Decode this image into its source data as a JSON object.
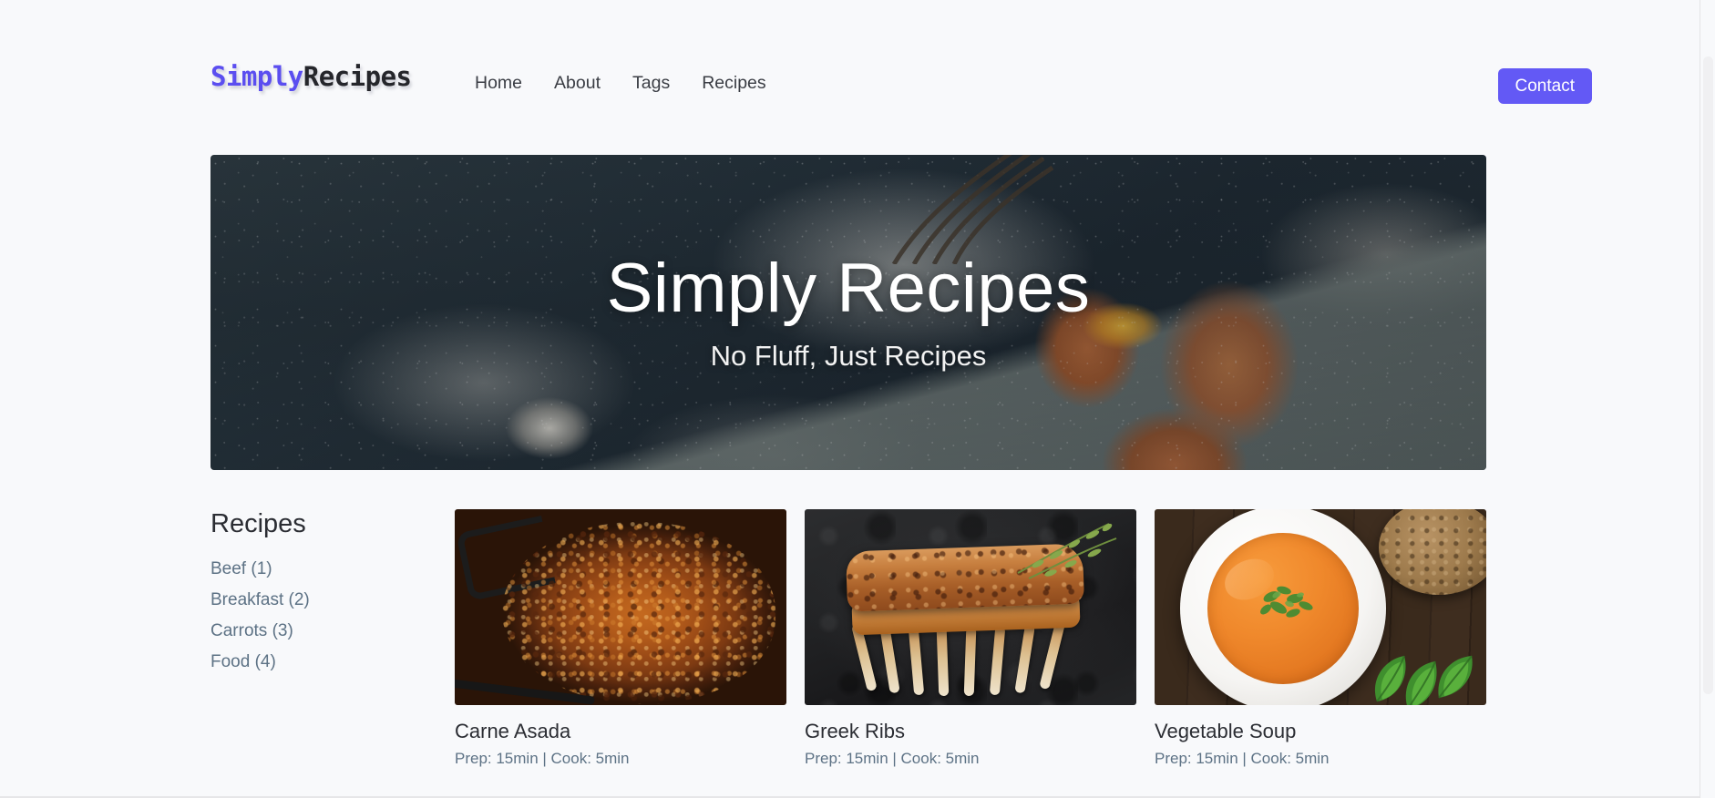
{
  "site": {
    "background_color": "#f8f9fb",
    "accent_color": "#6359f5"
  },
  "header": {
    "brand": {
      "part1": "Simply",
      "part1_color": "#5b4ef0",
      "part2": "Recipes",
      "part2_color": "#25262b"
    },
    "nav": [
      {
        "label": "Home"
      },
      {
        "label": "About"
      },
      {
        "label": "Tags"
      },
      {
        "label": "Recipes"
      }
    ],
    "contact_button": "Contact"
  },
  "hero": {
    "title": "Simply Recipes",
    "subtitle": "No Fluff, Just Recipes",
    "image_alt": "flour scattered on a dark slate surface with brown eggs, a cracked egg yolk, a whisk and a grey cloth"
  },
  "sidebar": {
    "title": "Recipes",
    "tags": [
      {
        "label": "Beef (1)"
      },
      {
        "label": "Breakfast (2)"
      },
      {
        "label": "Carrots (3)"
      },
      {
        "label": "Food (4)"
      }
    ]
  },
  "recipes": [
    {
      "title": "Carne Asada",
      "meta": "Prep: 15min | Cook: 5min",
      "image_alt": "browned shredded beef cooking in a dark skillet on a stove"
    },
    {
      "title": "Greek Ribs",
      "meta": "Prep: 15min | Cook: 5min",
      "image_alt": "roasted rack of ribs on dark slate garnished with thyme sprigs"
    },
    {
      "title": "Vegetable Soup",
      "meta": "Prep: 15min | Cook: 5min",
      "image_alt": "orange vegetable soup in a white bowl with herbs, bread roll and basil on dark wood"
    }
  ]
}
